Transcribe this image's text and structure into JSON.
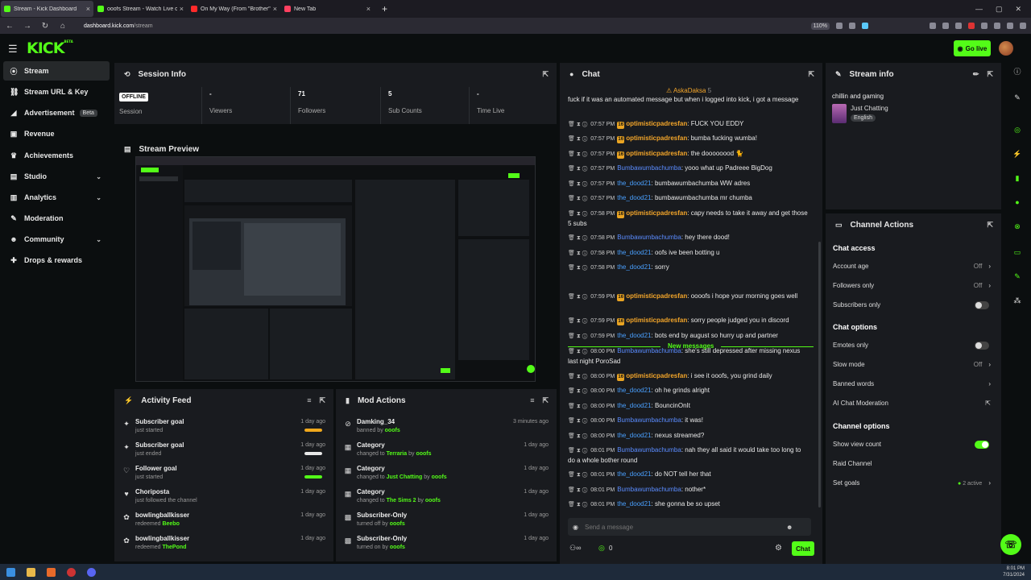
{
  "browser": {
    "tabs": [
      {
        "title": "Stream - Kick Dashboard",
        "color": "#53fc18",
        "active": true
      },
      {
        "title": "ooofs Stream - Watch Live on K",
        "color": "#53fc18",
        "active": false
      },
      {
        "title": "On My Way (From \"Brother\"",
        "color": "#ff2a2a",
        "active": false
      },
      {
        "title": "New Tab",
        "color": "#ff4060",
        "active": false
      }
    ],
    "url_host": "dashboard.kick.com",
    "url_path": "/stream",
    "zoom": "110%"
  },
  "header": {
    "logo": "KICK",
    "logo_beta": "BETA",
    "go_live_label": "Go live"
  },
  "sidebar": {
    "items": [
      {
        "label": "Stream",
        "icon": "radio-icon",
        "glyph": "⦿",
        "active": true
      },
      {
        "label": "Stream URL & Key",
        "icon": "link-icon",
        "glyph": "⛓",
        "active": false
      },
      {
        "label": "Advertisement",
        "icon": "megaphone-icon",
        "glyph": "◢",
        "active": false,
        "badge": "Beta"
      },
      {
        "label": "Revenue",
        "icon": "wallet-icon",
        "glyph": "▣",
        "active": false
      },
      {
        "label": "Achievements",
        "icon": "trophy-icon",
        "glyph": "♛",
        "active": false
      },
      {
        "label": "Studio",
        "icon": "studio-icon",
        "glyph": "▤",
        "active": false,
        "chevron": true
      },
      {
        "label": "Analytics",
        "icon": "chart-icon",
        "glyph": "▥",
        "active": false,
        "chevron": true
      },
      {
        "label": "Moderation",
        "icon": "wrench-icon",
        "glyph": "✎",
        "active": false
      },
      {
        "label": "Community",
        "icon": "users-icon",
        "glyph": "☻",
        "active": false,
        "chevron": true
      },
      {
        "label": "Drops & rewards",
        "icon": "gift-icon",
        "glyph": "✚",
        "active": false
      }
    ]
  },
  "session_info": {
    "title": "Session Info",
    "offline_label": "OFFLINE",
    "session_label": "Session",
    "stats": [
      {
        "value": "-",
        "label": "Viewers"
      },
      {
        "value": "71",
        "label": "Followers"
      },
      {
        "value": "5",
        "label": "Sub Counts"
      },
      {
        "value": "-",
        "label": "Time Live"
      }
    ]
  },
  "stream_preview": {
    "title": "Stream Preview"
  },
  "activity_feed": {
    "title": "Activity Feed",
    "items": [
      {
        "title": "Subscriber goal",
        "sub": "just started",
        "time": "1 day ago",
        "icon": "sparkle-icon",
        "glyph": "✦",
        "progress": 1.0,
        "bar_color": "#f0a81c"
      },
      {
        "title": "Subscriber goal",
        "sub": "just ended",
        "time": "1 day ago",
        "icon": "sparkle-icon",
        "glyph": "✦",
        "progress": 1.0,
        "bar_color": "#e8e8e8"
      },
      {
        "title": "Follower goal",
        "sub": "just started",
        "time": "1 day ago",
        "icon": "heart-outline-icon",
        "glyph": "♡",
        "progress": 1.0,
        "bar_color": "#53fc18"
      },
      {
        "title": "Choriposta",
        "sub": "just followed the channel",
        "time": "1 day ago",
        "icon": "heart-icon",
        "glyph": "♥"
      },
      {
        "title": "bowlingballkisser",
        "sub_prefix": "redeemed ",
        "sub_highlight": "Beebo",
        "time": "1 day ago",
        "icon": "reward-icon",
        "glyph": "✿"
      },
      {
        "title": "bowlingballkisser",
        "sub_prefix": "redeemed ",
        "sub_highlight": "ThePond",
        "time": "1 day ago",
        "icon": "reward-icon",
        "glyph": "✿"
      }
    ]
  },
  "mod_actions": {
    "title": "Mod Actions",
    "items": [
      {
        "title": "Damking_34",
        "pre": "banned by ",
        "hl1": "ooofs",
        "mid": "",
        "hl2": "",
        "time": "3 minutes ago",
        "icon": "ban-icon",
        "glyph": "⊘"
      },
      {
        "title": "Category",
        "pre": "changed to ",
        "hl1": "Terraria",
        "mid": " by ",
        "hl2": "ooofs",
        "time": "1 day ago",
        "icon": "category-icon",
        "glyph": "▦"
      },
      {
        "title": "Category",
        "pre": "changed to ",
        "hl1": "Just Chatting",
        "mid": " by ",
        "hl2": "ooofs",
        "time": "1 day ago",
        "icon": "category-icon",
        "glyph": "▦"
      },
      {
        "title": "Category",
        "pre": "changed to ",
        "hl1": "The Sims 2",
        "mid": " by ",
        "hl2": "ooofs",
        "time": "1 day ago",
        "icon": "category-icon",
        "glyph": "▦"
      },
      {
        "title": "Subscriber-Only",
        "pre": "turned off by ",
        "hl1": "ooofs",
        "mid": "",
        "hl2": "",
        "time": "1 day ago",
        "icon": "gift-icon",
        "glyph": "▩"
      },
      {
        "title": "Subscriber-Only",
        "pre": "turned on by ",
        "hl1": "ooofs",
        "mid": "",
        "hl2": "",
        "time": "1 day ago",
        "icon": "gift-icon",
        "glyph": "▩"
      }
    ]
  },
  "chat": {
    "title": "Chat",
    "pinned_user": "AskaDaksa",
    "pinned_count": "5",
    "top_text": "fuck if it was an automated message but when i logged into kick, i got a message that said I need to watch what i say",
    "new_messages_label": "New messages",
    "messages": [
      {
        "time": "07:57 PM",
        "user": "optimisticpadresfan",
        "cls": "u1",
        "badge": "16",
        "text": "FUCK YOU EDDY"
      },
      {
        "time": "07:57 PM",
        "user": "optimisticpadresfan",
        "cls": "u1",
        "badge": "16",
        "text": "bumba fucking wumba!"
      },
      {
        "time": "07:57 PM",
        "user": "optimisticpadresfan",
        "cls": "u1",
        "badge": "16",
        "text": "the doooooood 🐈"
      },
      {
        "time": "07:57 PM",
        "user": "Bumbawumbachumba",
        "cls": "u2",
        "text": "yooo what up Padreee BigDog"
      },
      {
        "time": "07:57 PM",
        "user": "the_dood21",
        "cls": "u3",
        "text": "bumbawumbachumba WW adres"
      },
      {
        "time": "07:57 PM",
        "user": "the_dood21",
        "cls": "u3",
        "text": "bumbawumbachumba mr chumba"
      },
      {
        "time": "07:58 PM",
        "user": "optimisticpadresfan",
        "cls": "u1",
        "badge": "16",
        "text": "capy needs to take it away and get those 5 subs"
      },
      {
        "time": "07:58 PM",
        "user": "Bumbawumbachumba",
        "cls": "u2",
        "text": "hey there dood!"
      },
      {
        "time": "07:58 PM",
        "user": "the_dood21",
        "cls": "u3",
        "text": "oofs ive been botting u"
      },
      {
        "time": "07:58 PM",
        "user": "the_dood21",
        "cls": "u3",
        "text": "sorry"
      },
      {
        "time": "07:59 PM",
        "user": "optimisticpadresfan",
        "cls": "u1",
        "badge": "16",
        "text": "oooofs i hope your morning goes well"
      },
      {
        "time": "07:59 PM",
        "user": "optimisticpadresfan",
        "cls": "u1",
        "badge": "16",
        "text": "sorry people judged you in discord"
      },
      {
        "time": "07:59 PM",
        "user": "the_dood21",
        "cls": "u3",
        "text": "bots end by august so hurry up and partner"
      },
      {
        "time": "08:00 PM",
        "user": "Bumbawumbachumba",
        "cls": "u2",
        "text": "she's still depressed after missing nexus last night PoroSad"
      },
      {
        "time": "08:00 PM",
        "user": "optimisticpadresfan",
        "cls": "u1",
        "badge": "16",
        "text": "i see it ooofs, you grind daily"
      },
      {
        "time": "08:00 PM",
        "user": "the_dood21",
        "cls": "u3",
        "text": "oh he grinds alright"
      },
      {
        "time": "08:00 PM",
        "user": "the_dood21",
        "cls": "u3",
        "text": "BouncinOnIt"
      },
      {
        "time": "08:00 PM",
        "user": "Bumbawumbachumba",
        "cls": "u2",
        "text": "it was!"
      },
      {
        "time": "08:00 PM",
        "user": "the_dood21",
        "cls": "u3",
        "text": "nexus streamed?"
      },
      {
        "time": "08:01 PM",
        "user": "Bumbawumbachumba",
        "cls": "u2",
        "text": "nah they all said it would take too long to do a whole bother round"
      },
      {
        "time": "08:01 PM",
        "user": "the_dood21",
        "cls": "u3",
        "text": "do NOT tell her that"
      },
      {
        "time": "08:01 PM",
        "user": "Bumbawumbachumba",
        "cls": "u2",
        "text": "nother*"
      },
      {
        "time": "08:01 PM",
        "user": "the_dood21",
        "cls": "u3",
        "text": "she gonna be so upset"
      }
    ],
    "input_placeholder": "Send a message",
    "points": "0",
    "send_label": "Chat"
  },
  "stream_info": {
    "title": "Stream info",
    "stream_title": "chillin and gaming",
    "category": "Just Chatting",
    "language": "English"
  },
  "channel_actions": {
    "title": "Channel Actions",
    "sections": [
      {
        "heading": "Chat access",
        "rows": [
          {
            "label": "Account age",
            "value": "Off",
            "kind": "chevron"
          },
          {
            "label": "Followers only",
            "value": "Off",
            "kind": "chevron"
          },
          {
            "label": "Subscribers only",
            "kind": "toggle",
            "on": false
          }
        ]
      },
      {
        "heading": "Chat options",
        "rows": [
          {
            "label": "Emotes only",
            "kind": "toggle",
            "on": false
          },
          {
            "label": "Slow mode",
            "value": "Off",
            "kind": "chevron"
          },
          {
            "label": "Banned words",
            "kind": "chevron"
          },
          {
            "label": "AI Chat Moderation",
            "kind": "external"
          }
        ]
      },
      {
        "heading": "Channel options",
        "rows": [
          {
            "label": "Show view count",
            "kind": "toggle",
            "on": true
          },
          {
            "label": "Raid Channel",
            "kind": "none"
          },
          {
            "label": "Set goals",
            "value": "2 active",
            "kind": "chevron"
          }
        ]
      }
    ]
  },
  "taskbar": {
    "time": "8:01 PM",
    "date": "7/31/2024"
  },
  "colors": {
    "accent": "#53fc18",
    "panel": "#191b1f",
    "background": "#0b0e0f"
  }
}
